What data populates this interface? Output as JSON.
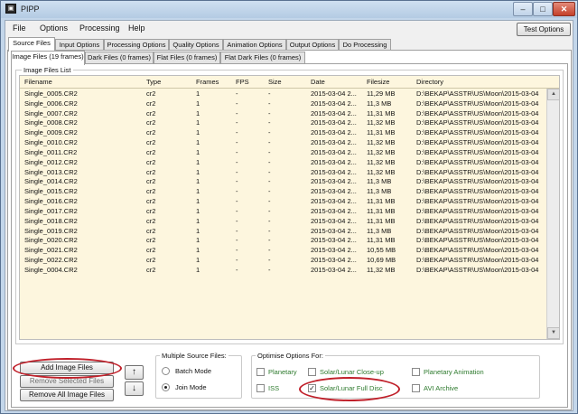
{
  "window": {
    "title": "PIPP",
    "icon_label": "PIPP"
  },
  "titlebar_buttons": {
    "minimize": "–",
    "maximize": "□",
    "close": "✕"
  },
  "menu": [
    "File",
    "Options",
    "Processing",
    "Help"
  ],
  "test_options_label": "Test Options",
  "main_tabs": [
    "Source Files",
    "Input Options",
    "Processing Options",
    "Quality Options",
    "Animation Options",
    "Output Options",
    "Do Processing"
  ],
  "sub_tabs": [
    "Image Files (19 frames)",
    "Dark Files (0 frames)",
    "Flat Files (0 frames)",
    "Flat Dark Files (0 frames)"
  ],
  "list": {
    "group_label": "Image Files List",
    "columns": [
      "Filename",
      "Type",
      "Frames",
      "FPS",
      "Size",
      "Date",
      "Filesize",
      "Directory"
    ],
    "rows": [
      [
        "Single_0005.CR2",
        "cr2",
        "1",
        "-",
        "-",
        "2015-03-04 2...",
        "11,29 MB",
        "D:\\BEKAP\\ASSTR\\US\\Moon\\2015-03-04"
      ],
      [
        "Single_0006.CR2",
        "cr2",
        "1",
        "-",
        "-",
        "2015-03-04 2...",
        "11,3 MB",
        "D:\\BEKAP\\ASSTR\\US\\Moon\\2015-03-04"
      ],
      [
        "Single_0007.CR2",
        "cr2",
        "1",
        "-",
        "-",
        "2015-03-04 2...",
        "11,31 MB",
        "D:\\BEKAP\\ASSTR\\US\\Moon\\2015-03-04"
      ],
      [
        "Single_0008.CR2",
        "cr2",
        "1",
        "-",
        "-",
        "2015-03-04 2...",
        "11,32 MB",
        "D:\\BEKAP\\ASSTR\\US\\Moon\\2015-03-04"
      ],
      [
        "Single_0009.CR2",
        "cr2",
        "1",
        "-",
        "-",
        "2015-03-04 2...",
        "11,31 MB",
        "D:\\BEKAP\\ASSTR\\US\\Moon\\2015-03-04"
      ],
      [
        "Single_0010.CR2",
        "cr2",
        "1",
        "-",
        "-",
        "2015-03-04 2...",
        "11,32 MB",
        "D:\\BEKAP\\ASSTR\\US\\Moon\\2015-03-04"
      ],
      [
        "Single_0011.CR2",
        "cr2",
        "1",
        "-",
        "-",
        "2015-03-04 2...",
        "11,32 MB",
        "D:\\BEKAP\\ASSTR\\US\\Moon\\2015-03-04"
      ],
      [
        "Single_0012.CR2",
        "cr2",
        "1",
        "-",
        "-",
        "2015-03-04 2...",
        "11,32 MB",
        "D:\\BEKAP\\ASSTR\\US\\Moon\\2015-03-04"
      ],
      [
        "Single_0013.CR2",
        "cr2",
        "1",
        "-",
        "-",
        "2015-03-04 2...",
        "11,32 MB",
        "D:\\BEKAP\\ASSTR\\US\\Moon\\2015-03-04"
      ],
      [
        "Single_0014.CR2",
        "cr2",
        "1",
        "-",
        "-",
        "2015-03-04 2...",
        "11,3 MB",
        "D:\\BEKAP\\ASSTR\\US\\Moon\\2015-03-04"
      ],
      [
        "Single_0015.CR2",
        "cr2",
        "1",
        "-",
        "-",
        "2015-03-04 2...",
        "11,3 MB",
        "D:\\BEKAP\\ASSTR\\US\\Moon\\2015-03-04"
      ],
      [
        "Single_0016.CR2",
        "cr2",
        "1",
        "-",
        "-",
        "2015-03-04 2...",
        "11,31 MB",
        "D:\\BEKAP\\ASSTR\\US\\Moon\\2015-03-04"
      ],
      [
        "Single_0017.CR2",
        "cr2",
        "1",
        "-",
        "-",
        "2015-03-04 2...",
        "11,31 MB",
        "D:\\BEKAP\\ASSTR\\US\\Moon\\2015-03-04"
      ],
      [
        "Single_0018.CR2",
        "cr2",
        "1",
        "-",
        "-",
        "2015-03-04 2...",
        "11,31 MB",
        "D:\\BEKAP\\ASSTR\\US\\Moon\\2015-03-04"
      ],
      [
        "Single_0019.CR2",
        "cr2",
        "1",
        "-",
        "-",
        "2015-03-04 2...",
        "11,3 MB",
        "D:\\BEKAP\\ASSTR\\US\\Moon\\2015-03-04"
      ],
      [
        "Single_0020.CR2",
        "cr2",
        "1",
        "-",
        "-",
        "2015-03-04 2...",
        "11,31 MB",
        "D:\\BEKAP\\ASSTR\\US\\Moon\\2015-03-04"
      ],
      [
        "Single_0021.CR2",
        "cr2",
        "1",
        "-",
        "-",
        "2015-03-04 2...",
        "10,55 MB",
        "D:\\BEKAP\\ASSTR\\US\\Moon\\2015-03-04"
      ],
      [
        "Single_0022.CR2",
        "cr2",
        "1",
        "-",
        "-",
        "2015-03-04 2...",
        "10,69 MB",
        "D:\\BEKAP\\ASSTR\\US\\Moon\\2015-03-04"
      ],
      [
        "Single_0004.CR2",
        "cr2",
        "1",
        "-",
        "-",
        "2015-03-04 2...",
        "11,32 MB",
        "D:\\BEKAP\\ASSTR\\US\\Moon\\2015-03-04"
      ]
    ]
  },
  "buttons": {
    "add": "Add Image Files",
    "remove_selected": "Remove Selected Files",
    "remove_all": "Remove All Image Files",
    "move_up": "↑",
    "move_down": "↓"
  },
  "multi_source": {
    "label": "Multiple Source Files:",
    "batch": "Batch Mode",
    "join": "Join Mode",
    "selected": "Join Mode"
  },
  "optimise": {
    "label": "Optimise Options For:",
    "planetary": "Planetary",
    "lunar_closeup": "Solar/Lunar Close-up",
    "planetary_animation": "Planetary Animation",
    "iss": "ISS",
    "lunar_full_disc": "Solar/Lunar Full Disc",
    "avi_archive": "AVI Archive",
    "checked_mark": "✓",
    "checked": "Solar/Lunar Full Disc"
  },
  "colors": {
    "highlight": "#c0202a",
    "list_background": "#fdf6de",
    "option_text": "#2d7a2d"
  }
}
